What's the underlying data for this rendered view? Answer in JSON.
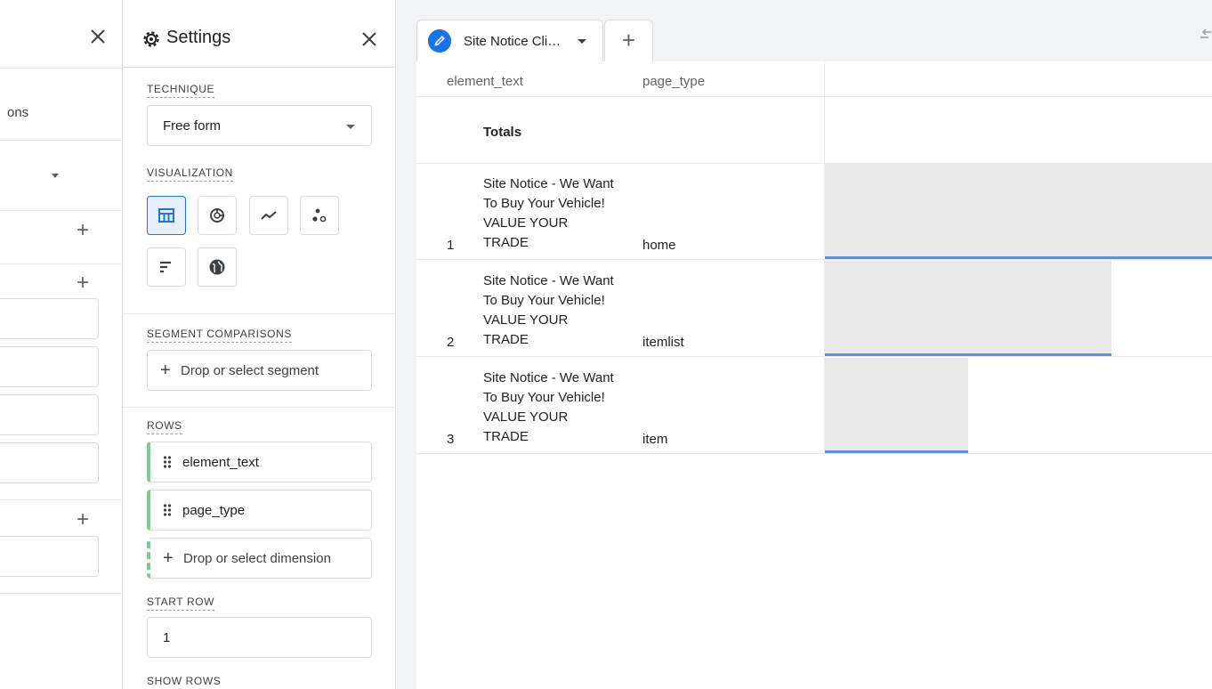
{
  "left_panel": {
    "partial_label": "ons",
    "plus_glyph": "+"
  },
  "settings": {
    "title": "Settings",
    "technique": {
      "label": "TECHNIQUE",
      "value": "Free form"
    },
    "visualization": {
      "label": "VISUALIZATION",
      "options": [
        {
          "icon": "table-icon",
          "selected": true
        },
        {
          "icon": "donut-chart-icon",
          "selected": false
        },
        {
          "icon": "line-chart-icon",
          "selected": false
        },
        {
          "icon": "scatter-chart-icon",
          "selected": false
        },
        {
          "icon": "bar-chart-icon",
          "selected": false
        },
        {
          "icon": "globe-icon",
          "selected": false
        }
      ]
    },
    "segment_comparisons": {
      "label": "SEGMENT COMPARISONS",
      "drop_text": "Drop or select segment"
    },
    "rows": {
      "label": "ROWS",
      "items": [
        "element_text",
        "page_type"
      ],
      "drop_text": "Drop or select dimension"
    },
    "start_row": {
      "label": "START ROW",
      "value": "1"
    },
    "show_rows": {
      "label": "SHOW ROWS"
    }
  },
  "canvas": {
    "tab": {
      "label": "Site Notice Cli…"
    },
    "add_tab_glyph": "+",
    "table": {
      "columns": [
        "element_text",
        "page_type"
      ],
      "totals_label": "Totals",
      "rows": [
        {
          "num": "1",
          "element_text": "Site Notice - We Want To Buy Your Vehicle! VALUE YOUR TRADE",
          "page_type": "home",
          "metric_fraction": 1.0
        },
        {
          "num": "2",
          "element_text": "Site Notice - We Want To Buy Your Vehicle! VALUE YOUR TRADE",
          "page_type": "itemlist",
          "metric_fraction": 0.74
        },
        {
          "num": "3",
          "element_text": "Site Notice - We Want To Buy Your Vehicle! VALUE YOUR TRADE",
          "page_type": "item",
          "metric_fraction": 0.37
        }
      ]
    }
  },
  "colors": {
    "accent": "#1a73e8",
    "bar_fill": "#e8e8e8",
    "bar_line": "#5c8fe0",
    "row_marker": "#81c995"
  }
}
